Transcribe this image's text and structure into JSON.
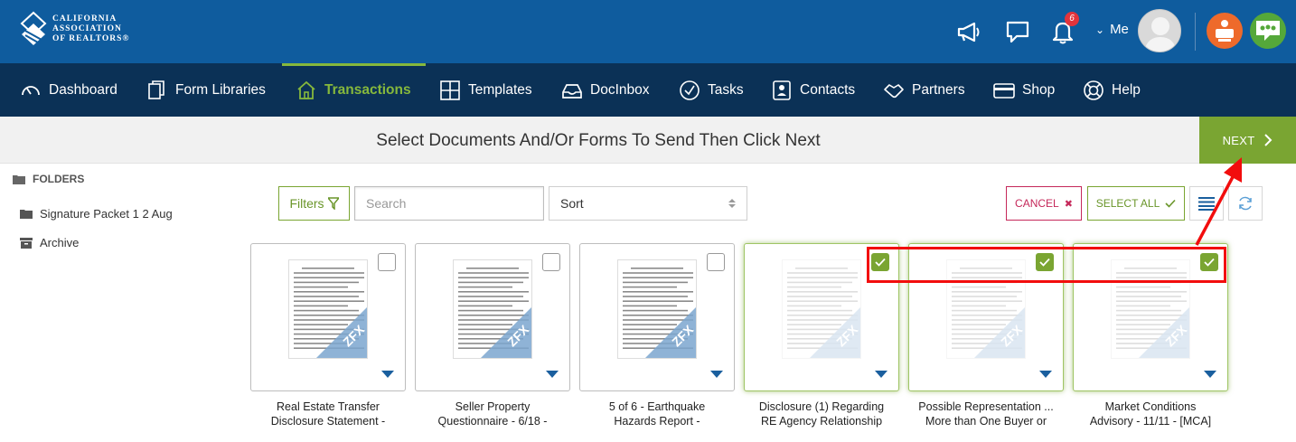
{
  "brand": {
    "line1": "CALIFORNIA",
    "line2": "ASSOCIATION",
    "line3": "OF REALTORS®"
  },
  "header": {
    "notification_count": "6",
    "me_label": "Me"
  },
  "nav": {
    "items": [
      {
        "label": "Dashboard",
        "icon": "gauge-icon"
      },
      {
        "label": "Form Libraries",
        "icon": "documents-icon"
      },
      {
        "label": "Transactions",
        "icon": "house-icon"
      },
      {
        "label": "Templates",
        "icon": "grid-icon"
      },
      {
        "label": "DocInbox",
        "icon": "inbox-icon"
      },
      {
        "label": "Tasks",
        "icon": "check-circle-icon"
      },
      {
        "label": "Contacts",
        "icon": "contact-card-icon"
      },
      {
        "label": "Partners",
        "icon": "handshake-icon"
      },
      {
        "label": "Shop",
        "icon": "credit-card-icon"
      },
      {
        "label": "Help",
        "icon": "lifebuoy-icon"
      }
    ],
    "active": "Transactions"
  },
  "title": {
    "text": "Select Documents And/Or Forms To Send Then Click Next",
    "next_label": "NEXT"
  },
  "sidebar": {
    "header": "FOLDERS",
    "items": [
      {
        "label": "Signature Packet 1 2 Aug"
      },
      {
        "label": "Archive"
      }
    ]
  },
  "toolbar": {
    "filters_label": "Filters",
    "search_placeholder": "Search",
    "sort_label": "Sort",
    "cancel_label": "CANCEL",
    "select_all_label": "SELECT ALL"
  },
  "documents": [
    {
      "line1": "Real Estate Transfer",
      "line2": "Disclosure Statement -",
      "watermark": "ZFX",
      "selected": false
    },
    {
      "line1": "Seller Property",
      "line2": "Questionnaire - 6/18 -",
      "watermark": "ZFX",
      "selected": false
    },
    {
      "line1": "5 of 6 - Earthquake",
      "line2": "Hazards Report -",
      "watermark": "ZFX",
      "selected": false
    },
    {
      "line1": "Disclosure (1) Regarding",
      "line2": "RE Agency Relationship",
      "watermark": "ZFX",
      "selected": true
    },
    {
      "line1": "Possible Representation ...",
      "line2": "More than One Buyer or",
      "watermark": "ZFX",
      "selected": true
    },
    {
      "line1": "Market Conditions",
      "line2": "Advisory - 11/11 - [MCA]",
      "watermark": "ZFX",
      "selected": true
    }
  ],
  "colors": {
    "header_blue": "#0f5c9e",
    "nav_navy": "#0b3156",
    "accent_green": "#7aa532",
    "cancel_red": "#c5285a",
    "annotation_red": "#f20d0d"
  }
}
